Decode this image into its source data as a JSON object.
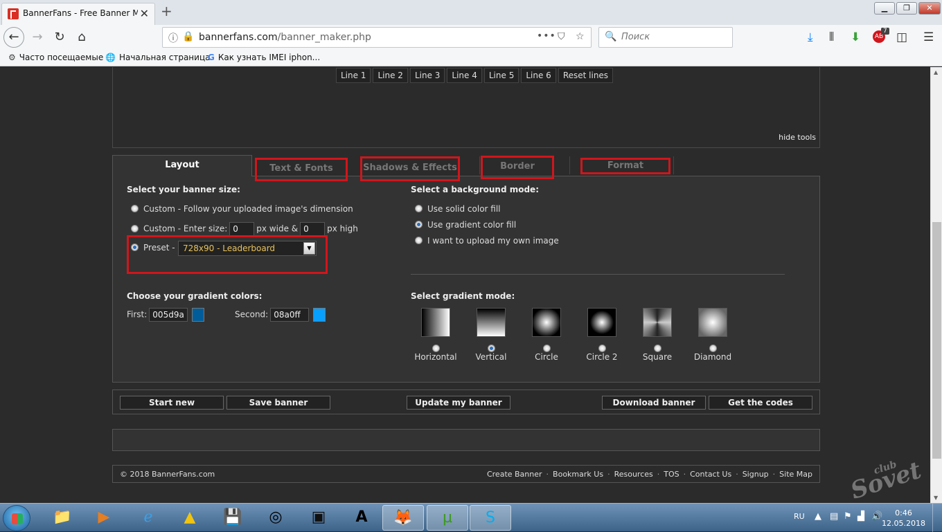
{
  "browser": {
    "tab_title": "BannerFans - Free Banner Maker",
    "url_domain": "bannerfans.com",
    "url_path": "/banner_maker.php",
    "search_placeholder": "Поиск",
    "addon_badge": "7",
    "bookmarks": [
      "Часто посещаемые",
      "Начальная страница",
      "Как узнать IMEI iphon..."
    ]
  },
  "tools": {
    "line_buttons": [
      "Line 1",
      "Line 2",
      "Line 3",
      "Line 4",
      "Line 5",
      "Line 6",
      "Reset lines"
    ],
    "hide_tools": "hide tools"
  },
  "tabs": {
    "layout": "Layout",
    "text_fonts": "Text & Fonts",
    "shadows": "Shadows & Effects",
    "border": "Border",
    "format": "Format"
  },
  "size": {
    "heading": "Select your banner size:",
    "custom_follow": "Custom - Follow your uploaded image's dimension",
    "custom_enter": "Custom - Enter size:",
    "width_value": "0",
    "px_wide": "px wide &",
    "height_value": "0",
    "px_high": "px high",
    "preset_label": "Preset -",
    "preset_value": "728x90 - Leaderboard"
  },
  "background": {
    "heading": "Select a background mode:",
    "solid": "Use solid color fill",
    "gradient": "Use gradient color fill",
    "upload": "I want to upload my own image"
  },
  "gradient_colors": {
    "heading": "Choose your gradient colors:",
    "first_label": "First:",
    "first_value": "005d9a",
    "first_color": "#005d9a",
    "second_label": "Second:",
    "second_value": "08a0ff",
    "second_color": "#08a0ff"
  },
  "gradient_mode": {
    "heading": "Select gradient mode:",
    "modes": [
      "Horizontal",
      "Vertical",
      "Circle",
      "Circle 2",
      "Square",
      "Diamond"
    ],
    "selected": "Vertical"
  },
  "actions": {
    "start_new": "Start new",
    "save_banner": "Save banner",
    "update": "Update my banner",
    "download": "Download banner",
    "get_codes": "Get the codes"
  },
  "footer": {
    "copyright": "© 2018 BannerFans.com",
    "links": [
      "Create Banner",
      "Bookmark Us",
      "Resources",
      "TOS",
      "Contact Us",
      "Signup",
      "Site Map"
    ]
  },
  "watermark": {
    "small": "club",
    "big": "Sovet"
  },
  "taskbar": {
    "lang": "RU",
    "time": "0:46",
    "date": "12.05.2018"
  },
  "highlight_color": "#d0161c"
}
